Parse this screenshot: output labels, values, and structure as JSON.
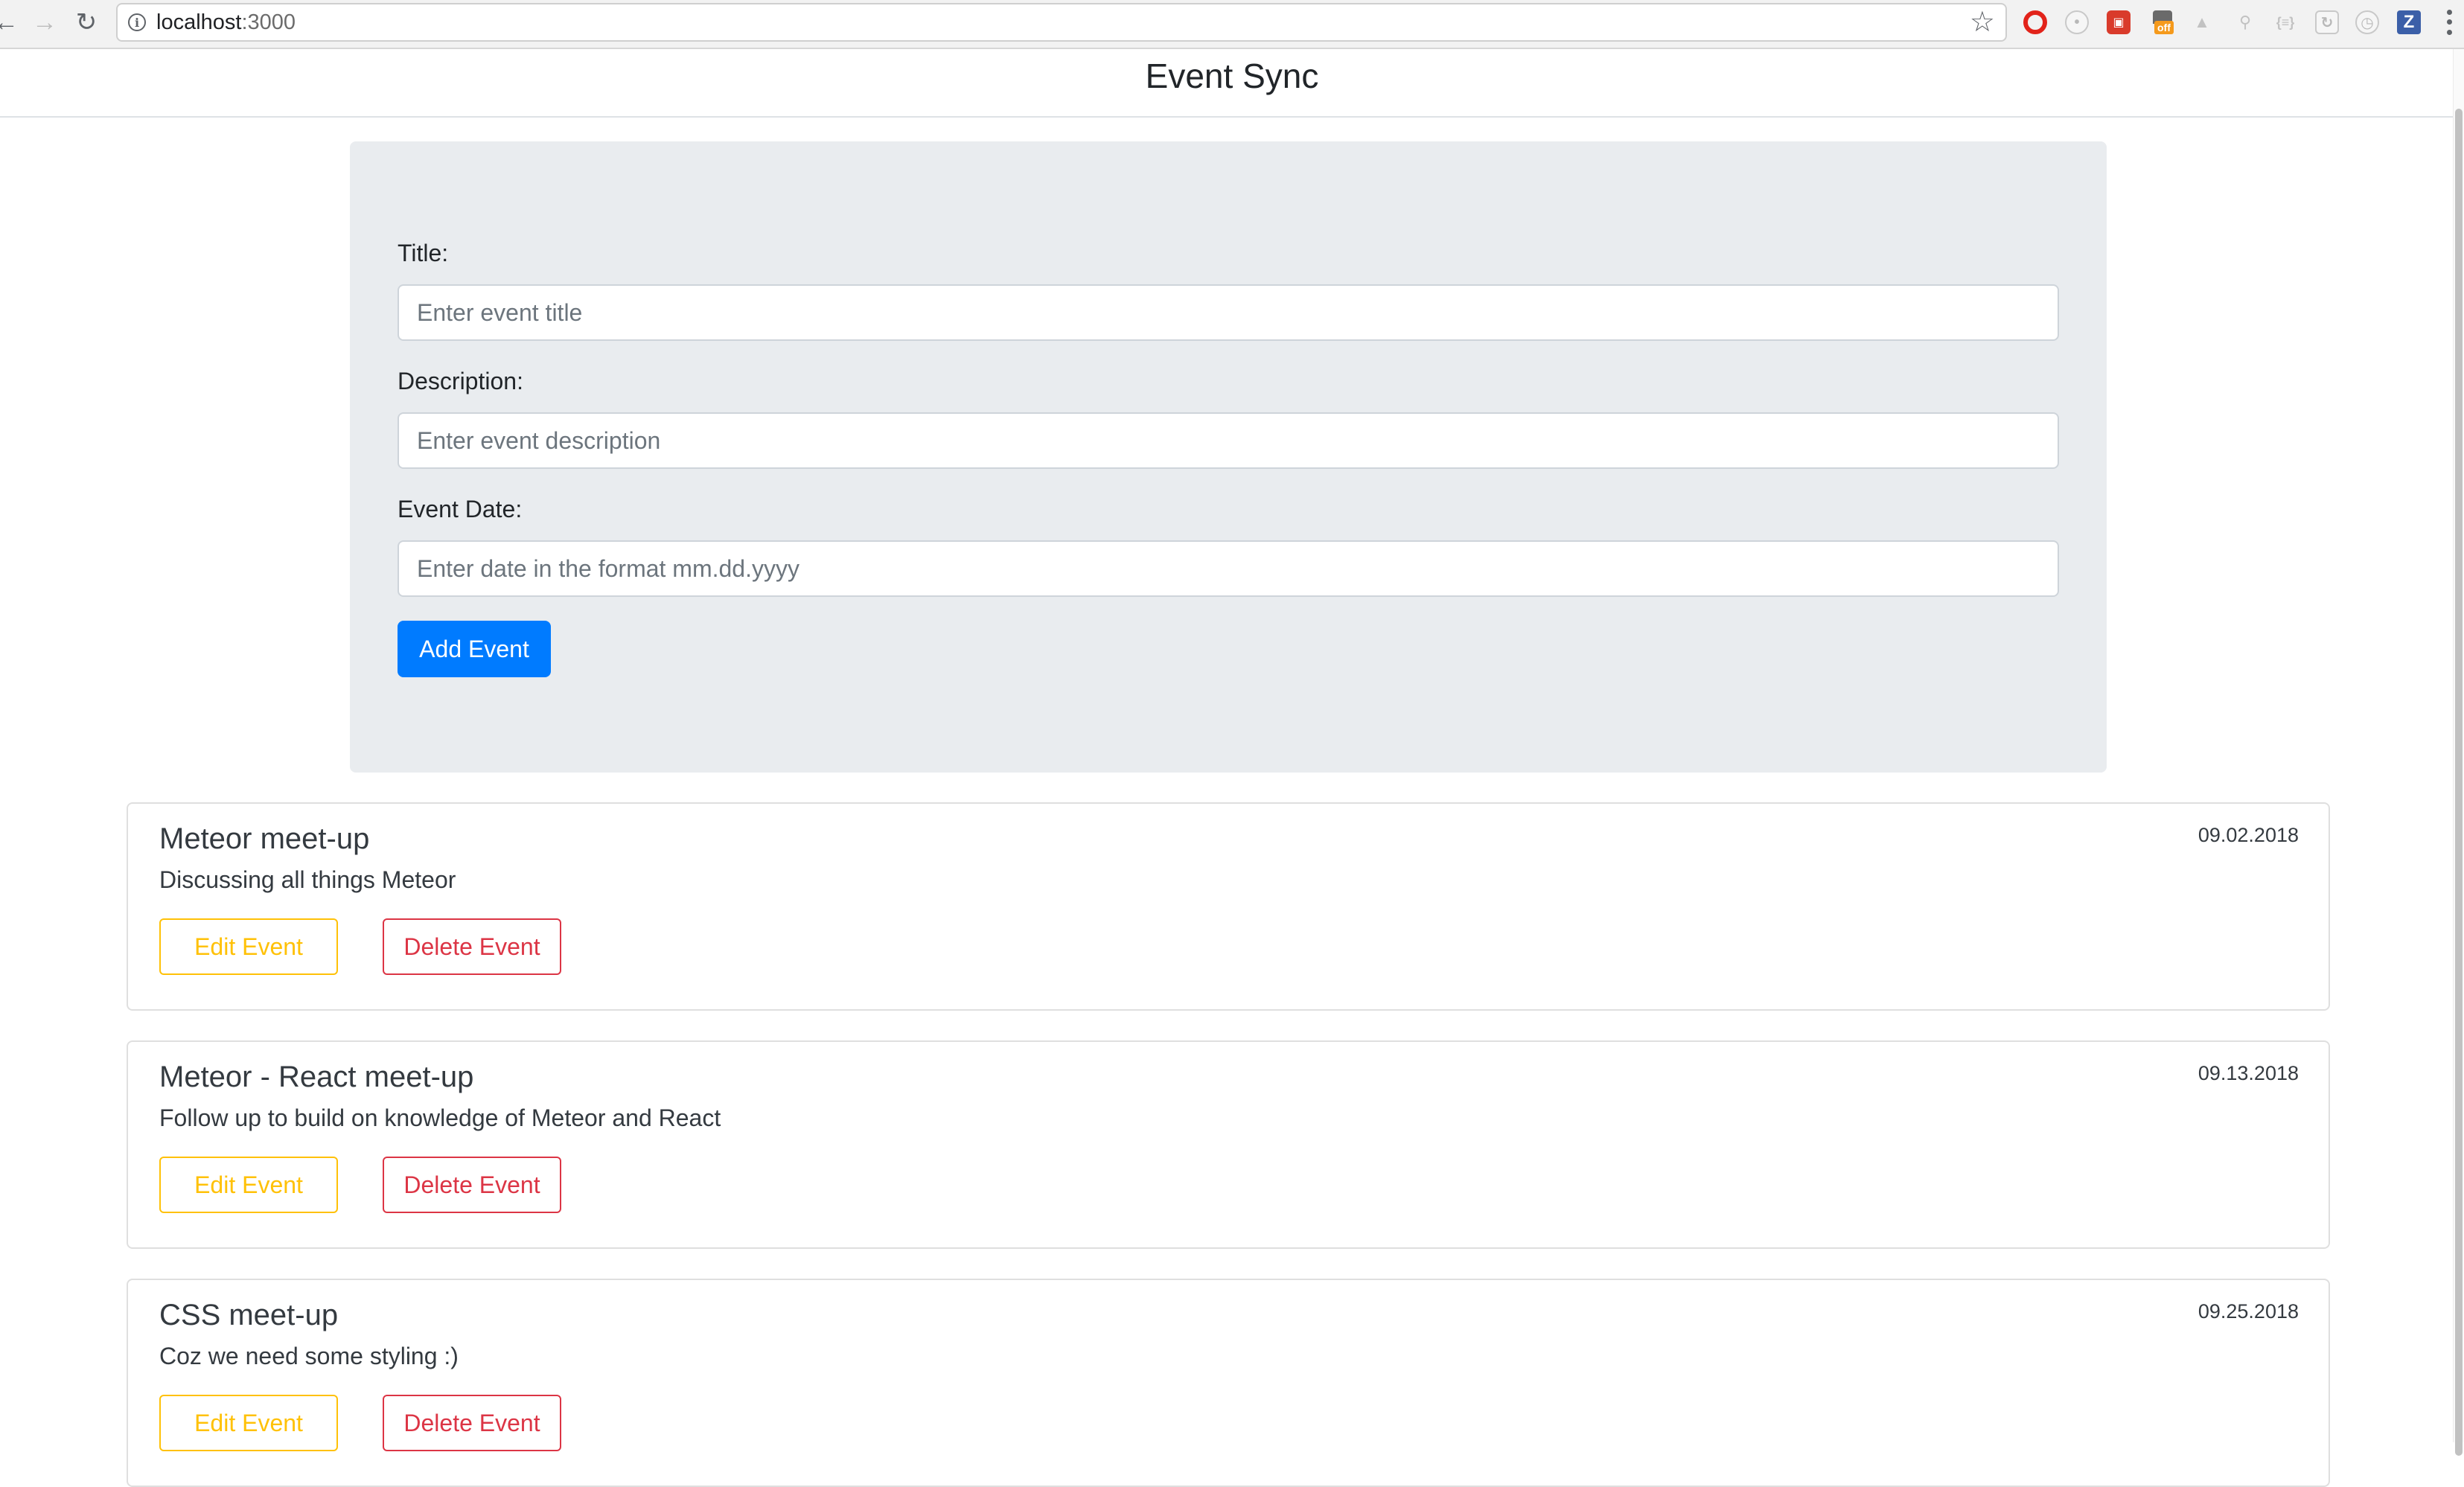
{
  "browser": {
    "url_host": "localhost",
    "url_port": ":3000",
    "icons": {
      "back": "back-arrow-icon",
      "forward": "forward-arrow-icon",
      "reload": "reload-icon",
      "info": "info-icon",
      "bookmark": "star-icon",
      "menu": "menu-dots-icon"
    },
    "extensions": [
      "opera-icon",
      "extension-icon",
      "extension-icon",
      "shopping-off-icon",
      "extension-icon",
      "search-extension-icon",
      "braces-extension-icon",
      "extension-icon",
      "clock-extension-icon",
      "z-extension-icon"
    ],
    "extension_badge": "off",
    "extension_z_label": "Z"
  },
  "app": {
    "title": "Event Sync"
  },
  "form": {
    "title_label": "Title:",
    "title_placeholder": "Enter event title",
    "description_label": "Description:",
    "description_placeholder": "Enter event description",
    "date_label": "Event Date:",
    "date_placeholder": "Enter date in the format mm.dd.yyyy",
    "submit_label": "Add Event"
  },
  "events": [
    {
      "title": "Meteor meet-up",
      "description": "Discussing all things Meteor",
      "date": "09.02.2018",
      "edit_label": "Edit Event",
      "delete_label": "Delete Event"
    },
    {
      "title": "Meteor - React meet-up",
      "description": "Follow up to build on knowledge of Meteor and React",
      "date": "09.13.2018",
      "edit_label": "Edit Event",
      "delete_label": "Delete Event"
    },
    {
      "title": "CSS meet-up",
      "description": "Coz we need some styling :)",
      "date": "09.25.2018",
      "edit_label": "Edit Event",
      "delete_label": "Delete Event"
    }
  ],
  "colors": {
    "primary": "#007bff",
    "warning": "#ffc107",
    "danger": "#dc3545",
    "jumbotron_bg": "#e9ecef"
  }
}
